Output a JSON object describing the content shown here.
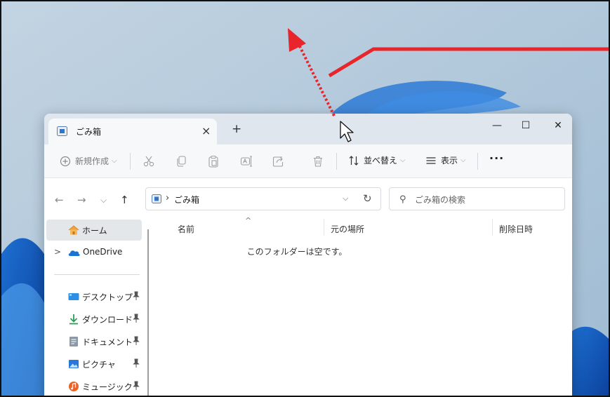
{
  "window": {
    "tab_label": "ごみ箱",
    "tab_close": "×",
    "new_tab": "+",
    "minimize": "—",
    "maximize": "☐",
    "close": "✕"
  },
  "toolbar": {
    "new_label": "新規作成",
    "new_icon": "plus-circle-icon",
    "new_chevron": "⌵",
    "icons": [
      "cut-icon",
      "copy-icon",
      "paste-icon",
      "rename-icon",
      "share-icon",
      "delete-icon"
    ],
    "sort_label": "並べ替え",
    "sort_chevron": "⌵",
    "view_label": "表示",
    "view_chevron": "⌵",
    "more_label": "···"
  },
  "navbar": {
    "back": "←",
    "forward": "→",
    "recent": "⌵",
    "up": "↑",
    "address_sep": "›",
    "address_text": "ごみ箱",
    "address_dropdown": "⌵",
    "refresh": "↻",
    "search_icon": "⚲",
    "search_placeholder": "ごみ箱の検索"
  },
  "sidebar": {
    "home_label": "ホーム",
    "onedrive_chevron": ">",
    "onedrive_label": "OneDrive",
    "items": [
      {
        "label": "デスクトップ",
        "icon": "desktop-icon"
      },
      {
        "label": "ダウンロード",
        "icon": "download-icon"
      },
      {
        "label": "ドキュメント",
        "icon": "documents-icon"
      },
      {
        "label": "ピクチャ",
        "icon": "pictures-icon"
      },
      {
        "label": "ミュージック",
        "icon": "music-icon"
      }
    ]
  },
  "content": {
    "columns": [
      "名前",
      "元の場所",
      "削除日時"
    ],
    "sort_caret": "^",
    "empty_message": "このフォルダーは空です。"
  },
  "colors": {
    "annotation_red": "#e8252a",
    "wallpaper_bg": "#a9c3d8",
    "titlebar_bg": "#dfe6ee",
    "toolbar_bg": "#f6f8fa",
    "selection_bg": "#e4e7ea"
  }
}
